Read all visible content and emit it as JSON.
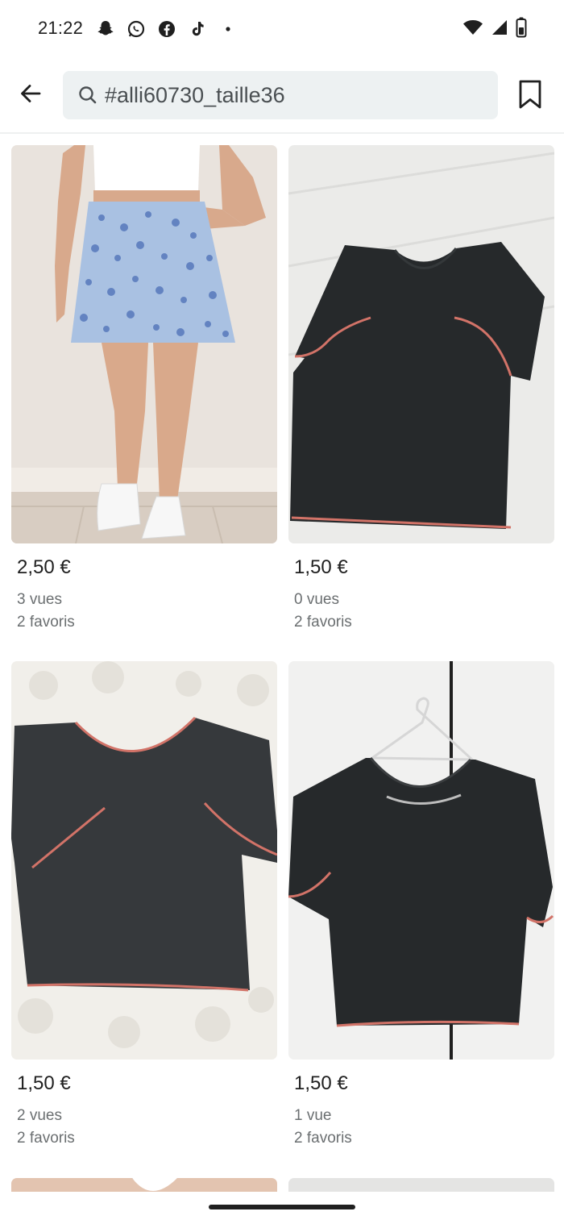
{
  "status_bar": {
    "time": "21:22",
    "left_icons": [
      "snapchat-icon",
      "whatsapp-icon",
      "facebook-icon",
      "tiktok-icon",
      "dot-icon"
    ],
    "right_icons": [
      "wifi-icon",
      "signal-icon",
      "battery-icon"
    ]
  },
  "header": {
    "back_icon": "arrow-left-icon",
    "search": {
      "icon": "search-icon",
      "value": "#alli60730_taille36"
    },
    "bookmark_icon": "bookmark-icon"
  },
  "items": [
    {
      "price": "2,50 €",
      "views": "3 vues",
      "favorites": "2 favoris",
      "photo": "floral mini skirt on model"
    },
    {
      "price": "1,50 €",
      "views": "0 vues",
      "favorites": "2 favoris",
      "photo": "black t-shirt with pink trim"
    },
    {
      "price": "1,50 €",
      "views": "2 vues",
      "favorites": "2 favoris",
      "photo": "black crop top on bed"
    },
    {
      "price": "1,50 €",
      "views": "1 vue",
      "favorites": "2 favoris",
      "photo": "black top on hanger"
    }
  ],
  "colors": {
    "search_bg": "#edf1f2",
    "text_primary": "#1f1f1f",
    "text_secondary": "#6b6f71",
    "trim_pink": "#d9776f"
  }
}
